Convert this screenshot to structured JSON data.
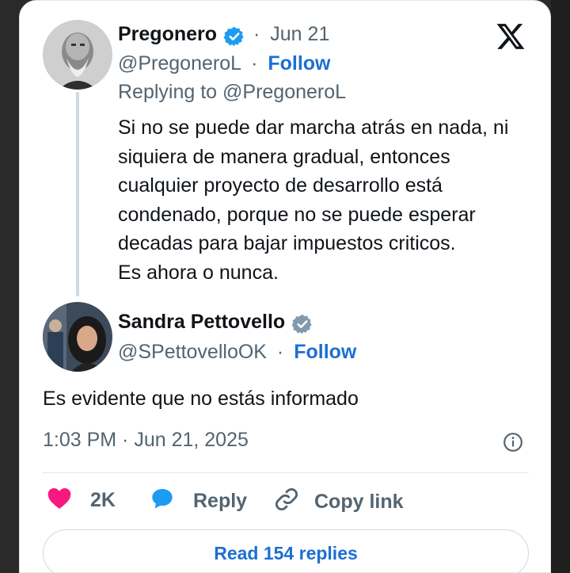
{
  "tweet": {
    "author": {
      "name": "Pregonero",
      "handle": "@PregoneroL",
      "follow_label": "Follow",
      "date": "Jun 21",
      "dot": "·"
    },
    "replying_to": "Replying to @PregoneroL",
    "text_lines": [
      "Si no se puede dar marcha atrás en nada, ni",
      "siquiera de manera gradual, entonces",
      "cualquier proyecto de desarrollo está",
      "condenado, porque no se puede esperar",
      "decadas para bajar impuestos criticos.",
      "Es ahora o nunca."
    ]
  },
  "reply": {
    "author": {
      "name": "Sandra Pettovello",
      "handle": "@SPettovelloOK",
      "follow_label": "Follow",
      "dot": "·"
    },
    "text": "Es evidente que no estás informado",
    "timestamp": "1:03 PM · Jun 21, 2025"
  },
  "actions": {
    "likes": "2K",
    "reply_label": "Reply",
    "copy_link_label": "Copy link"
  },
  "read_replies_label": "Read 154 replies",
  "icons": {
    "verified_blue": "verified-badge-icon",
    "verified_gray": "verified-badge-gray-icon",
    "platform": "x-logo-icon",
    "info": "info-icon",
    "like": "heart-icon",
    "reply": "speech-bubble-icon",
    "link": "link-icon"
  },
  "colors": {
    "accent": "#1d6fd1",
    "verified_blue": "#1d9bf0",
    "verified_gray": "#829aab",
    "heart": "#f91880",
    "text": "#0f1419",
    "muted": "#536471"
  }
}
